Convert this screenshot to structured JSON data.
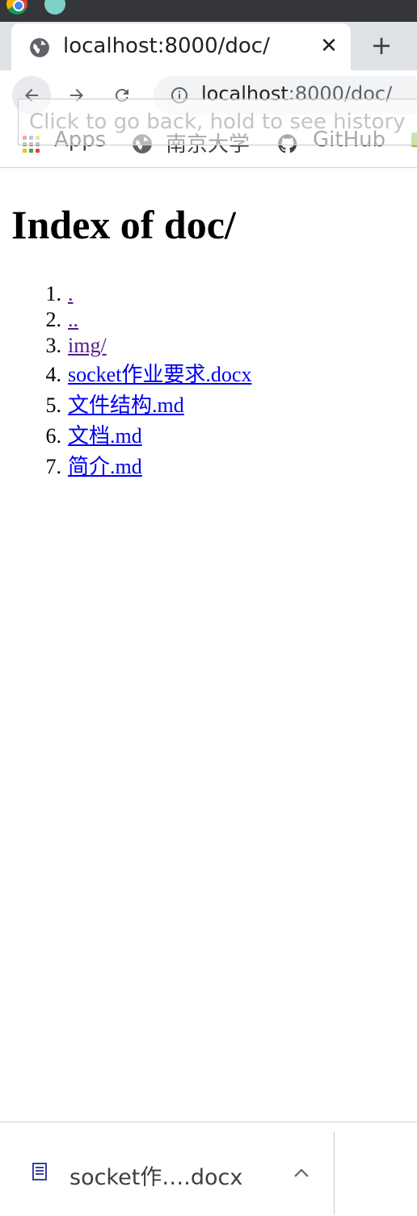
{
  "tab": {
    "title": "localhost:8000/doc/",
    "close_glyph": "✕",
    "new_tab_glyph": "+"
  },
  "omnibox": {
    "host": "localhost",
    "path": ":8000/doc/"
  },
  "tooltip": {
    "text": "Click to go back, hold to see history"
  },
  "bookmarks": [
    {
      "label": "Apps",
      "icon": "apps-grid-icon"
    },
    {
      "label": "南京大学",
      "icon": "globe-icon"
    },
    {
      "label": "GitHub",
      "icon": "github-icon"
    }
  ],
  "page": {
    "title": "Index of doc/",
    "files": [
      {
        "num": "1.",
        "name": "."
      },
      {
        "num": "2.",
        "name": ".."
      },
      {
        "num": "3.",
        "name": "img/"
      },
      {
        "num": "4.",
        "name": "socket作业要求.docx"
      },
      {
        "num": "5.",
        "name": "文件结构.md"
      },
      {
        "num": "6.",
        "name": "文档.md"
      },
      {
        "num": "7.",
        "name": "简介.md"
      }
    ]
  },
  "download": {
    "filename": "socket作….docx"
  },
  "colors": {
    "link": "#0000ee",
    "visited_link": "#551a8b",
    "tab_strip": "#dee1e6",
    "os_bar": "#35363a"
  }
}
